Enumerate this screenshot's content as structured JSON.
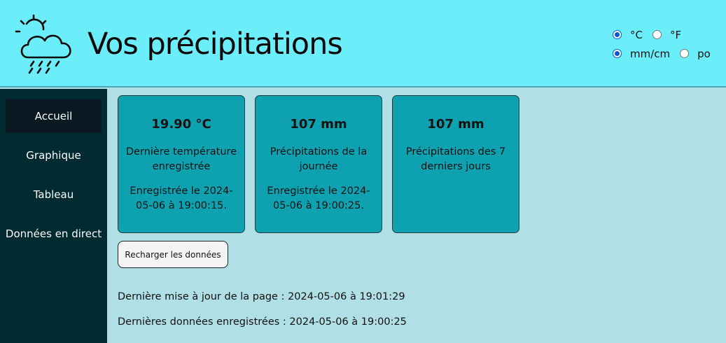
{
  "header": {
    "title": "Vos précipitations",
    "logo_icon": "weather-sun-cloud-rain-icon"
  },
  "units": {
    "temperature": [
      {
        "label": "°C",
        "selected": true
      },
      {
        "label": "°F",
        "selected": false
      }
    ],
    "precipitation": [
      {
        "label": "mm/cm",
        "selected": true
      },
      {
        "label": "po",
        "selected": false
      }
    ]
  },
  "sidebar": {
    "items": [
      {
        "label": "Accueil",
        "active": true
      },
      {
        "label": "Graphique",
        "active": false
      },
      {
        "label": "Tableau",
        "active": false
      },
      {
        "label": "Données en direct",
        "active": false
      }
    ]
  },
  "cards": [
    {
      "value": "19.90 °C",
      "label": "Dernière température enregistrée",
      "date": "Enregistrée le 2024-05-06 à 19:00:15."
    },
    {
      "value": "107 mm",
      "label": "Précipitations de la journée",
      "date": "Enregistrée le 2024-05-06 à 19:00:25."
    },
    {
      "value": "107 mm",
      "label": "Précipitations des 7 derniers jours",
      "date": ""
    }
  ],
  "reload_button": "Recharger les données",
  "info": {
    "last_update": "Dernière mise à jour de la page : 2024-05-06 à 19:01:29",
    "last_data": "Dernières données enregistrées : 2024-05-06 à 19:00:25"
  },
  "colors": {
    "header_bg": "#6beefa",
    "sidebar_bg": "#022b31",
    "main_bg": "#b0dfe6",
    "card_bg": "#0ea2b0"
  }
}
